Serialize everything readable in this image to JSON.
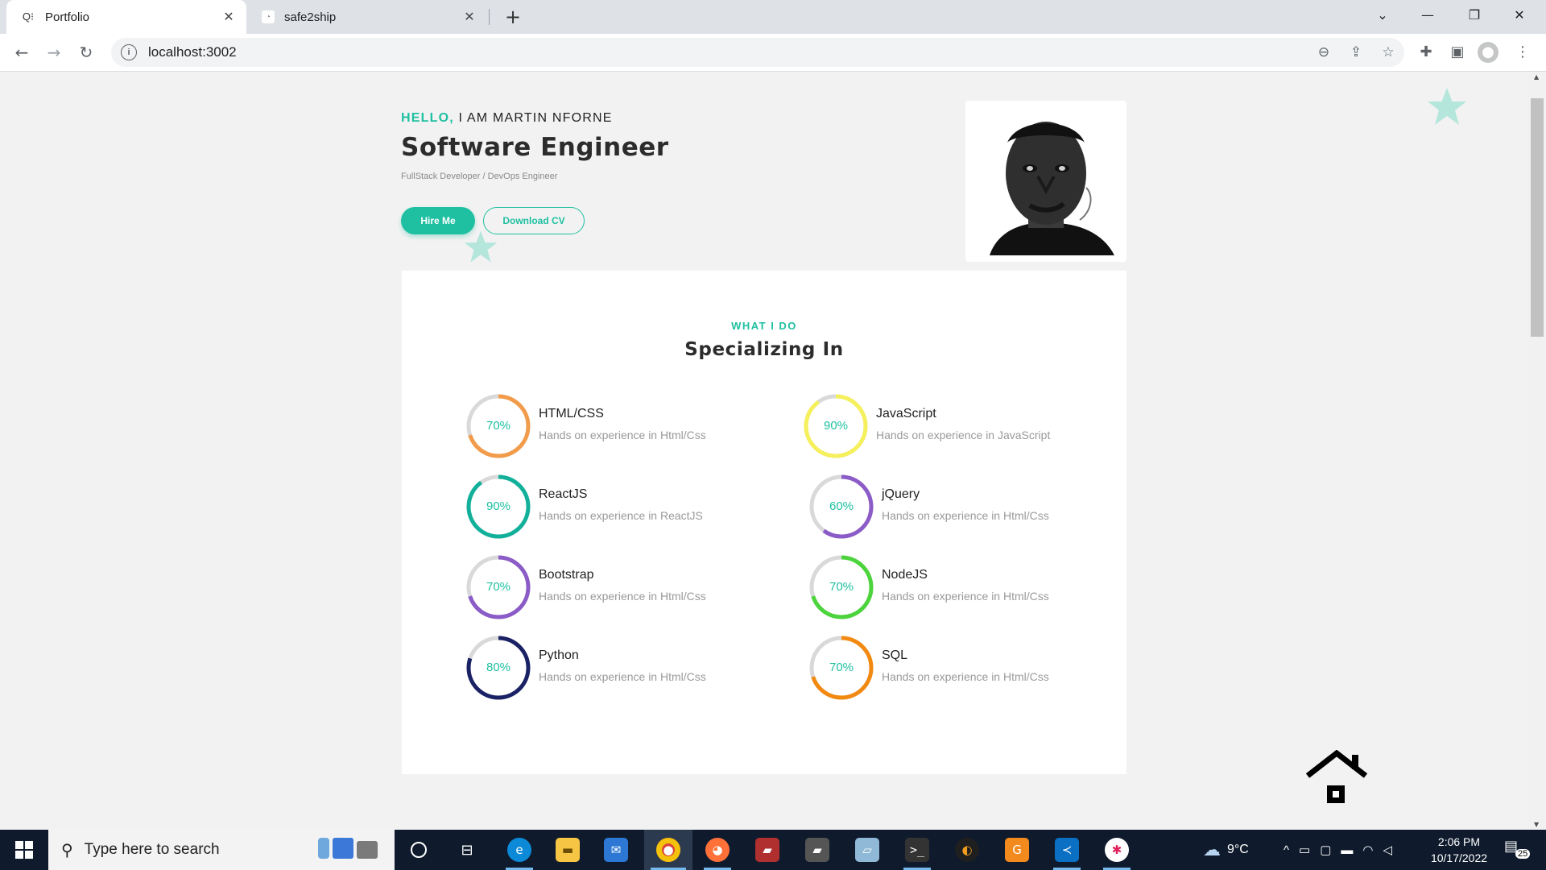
{
  "browser": {
    "tabs": [
      {
        "title": "Portfolio",
        "active": true
      },
      {
        "title": "safe2ship",
        "active": false
      }
    ],
    "url": "localhost:3002",
    "icons": {
      "back": "arrow-left-icon",
      "forward": "arrow-right-icon",
      "reload": "reload-icon",
      "zoom": "zoom-out-icon",
      "share": "share-icon",
      "bookmark": "star-icon",
      "extensions": "puzzle-icon",
      "sidepanel": "side-panel-icon",
      "profile": "profile-icon",
      "menu": "kebab-menu-icon"
    }
  },
  "hero": {
    "hello": "HELLO,",
    "intro": " I AM MARTIN NFORNE",
    "title": "Software Engineer",
    "subtitle": "FullStack Developer / DevOps Engineer",
    "hire_label": "Hire Me",
    "cv_label": "Download CV"
  },
  "services": {
    "eyebrow": "WHAT I DO",
    "title": "Specializing In",
    "skills": [
      {
        "name": "HTML/CSS",
        "desc": "Hands on experience in Html/Css",
        "percent": 70,
        "label": "70%",
        "color": "#f29c4b"
      },
      {
        "name": "JavaScript",
        "desc": "Hands on experience in JavaScript",
        "percent": 90,
        "label": "90%",
        "color": "#f5f05c"
      },
      {
        "name": "ReactJS",
        "desc": "Hands on experience in ReactJS",
        "percent": 90,
        "label": "90%",
        "color": "#12b09a"
      },
      {
        "name": "jQuery",
        "desc": "Hands on experience in Html/Css",
        "percent": 60,
        "label": "60%",
        "color": "#8b5cc7"
      },
      {
        "name": "Bootstrap",
        "desc": "Hands on experience in Html/Css",
        "percent": 70,
        "label": "70%",
        "color": "#8b5cc7"
      },
      {
        "name": "NodeJS",
        "desc": "Hands on experience in Html/Css",
        "percent": 70,
        "label": "70%",
        "color": "#4cd43c"
      },
      {
        "name": "Python",
        "desc": "Hands on experience in Html/Css",
        "percent": 80,
        "label": "80%",
        "color": "#1a2265"
      },
      {
        "name": "SQL",
        "desc": "Hands on experience in Html/Css",
        "percent": 70,
        "label": "70%",
        "color": "#f28a12"
      }
    ]
  },
  "colors": {
    "accent": "#1fc0a1",
    "ring_track": "#d9d9d9"
  },
  "taskbar": {
    "search_placeholder": "Type here to search",
    "weather": "9°C",
    "time": "2:06 PM",
    "date": "10/17/2022",
    "notification_count": "25"
  }
}
